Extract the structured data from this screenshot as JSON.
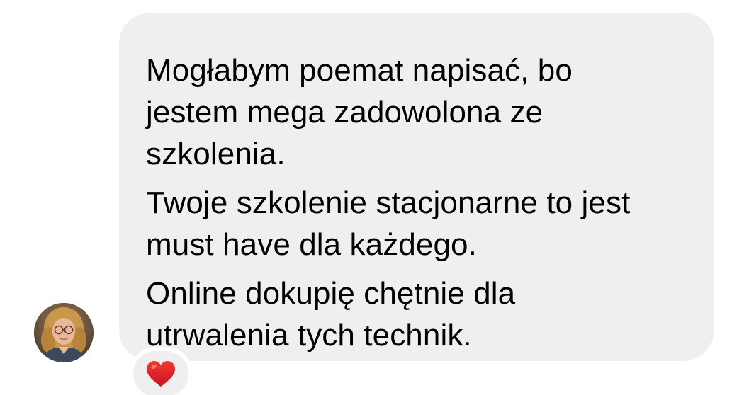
{
  "message": {
    "paragraphs": [
      "Mogłabym poemat napisać, bo\njestem mega zadowolona ze\nszkolenia.",
      "Twoje szkolenie stacjonarne to jest\nmust have dla każdego.",
      "Online dokupię chętnie dla\nutrwalenia tych technik."
    ]
  },
  "reaction": {
    "icon": "red-heart-icon",
    "color": "#e0201f"
  },
  "avatar": {
    "icon": "user-avatar"
  },
  "colors": {
    "bubble": "#efefef",
    "text": "#000000",
    "background": "#ffffff"
  }
}
